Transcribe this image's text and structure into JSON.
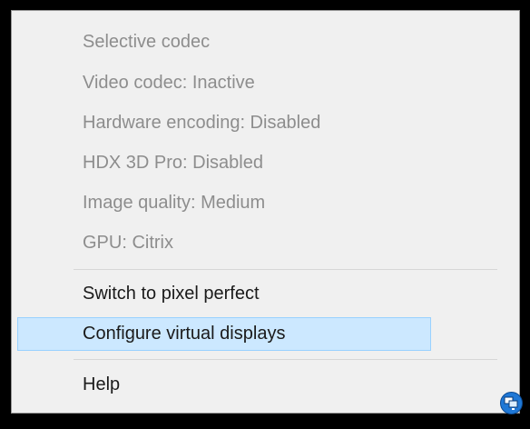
{
  "menu": {
    "status_items": [
      {
        "label": "Selective codec"
      },
      {
        "label": "Video codec: Inactive"
      },
      {
        "label": "Hardware encoding: Disabled"
      },
      {
        "label": "HDX 3D Pro: Disabled"
      },
      {
        "label": "Image quality: Medium"
      },
      {
        "label": "GPU: Citrix"
      }
    ],
    "switch_pixel_perfect": {
      "label": "Switch to pixel perfect"
    },
    "configure_virtual_displays": {
      "label": "Configure virtual displays",
      "highlighted": true
    },
    "help": {
      "label": "Help"
    }
  },
  "tray": {
    "icon": "virtual-displays-tray-icon"
  },
  "colors": {
    "menu_background": "#f0f0f0",
    "disabled_text": "#8d8d8d",
    "enabled_text": "#1a1a1a",
    "highlight_fill": "#cce8ff",
    "highlight_border": "#99d1ff",
    "screen_background": "#000000"
  }
}
